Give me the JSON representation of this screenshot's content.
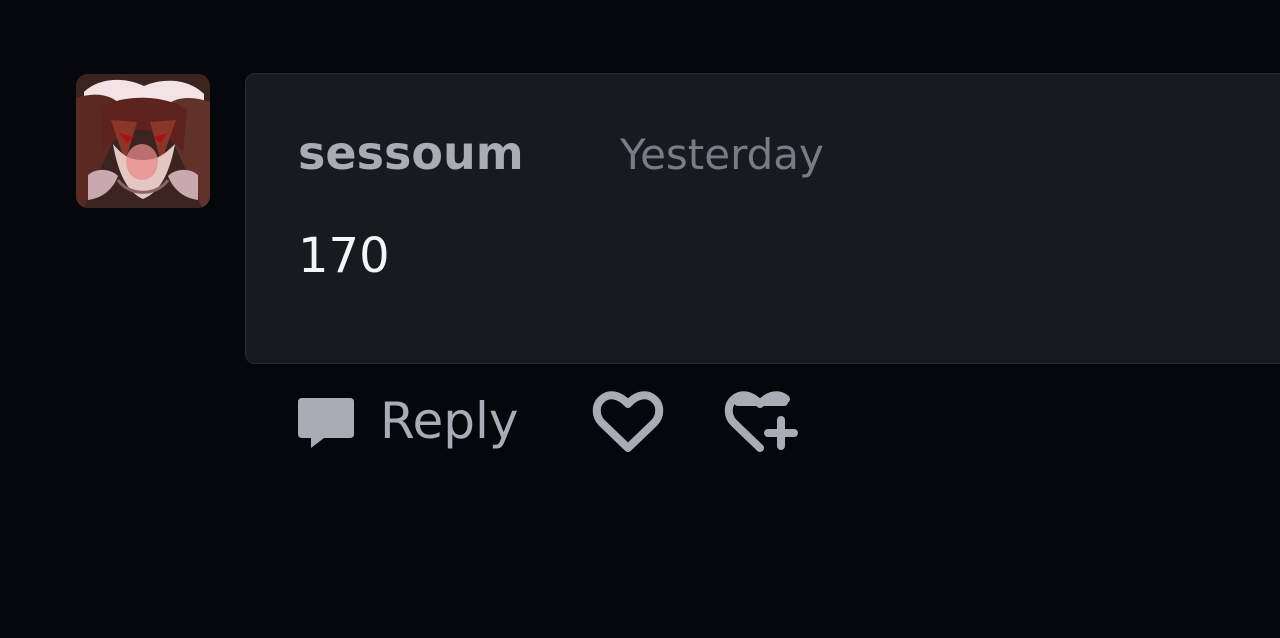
{
  "comment": {
    "author": "sessoum",
    "timestamp": "Yesterday",
    "body": "170",
    "avatar_icon": "user-avatar-image"
  },
  "actions": {
    "reply_label": "Reply",
    "reply_icon": "comment-bubble-icon",
    "like_icon": "heart-icon",
    "react_icon": "add-reaction-icon"
  },
  "colors": {
    "page_background": "#06070c",
    "card_background": "#181a20",
    "card_border": "#272a31",
    "username": "#a9acb4",
    "timestamp": "#787c85",
    "body_text": "#f4f5f7",
    "action_icon": "#a9acb4"
  }
}
